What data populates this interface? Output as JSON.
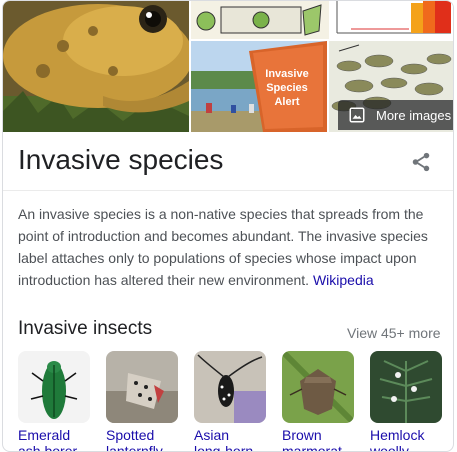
{
  "gallery": {
    "more_images_label": "More images",
    "sign_text_line1": "Invasive",
    "sign_text_line2": "Species",
    "sign_text_line3": "Alert"
  },
  "entity": {
    "title": "Invasive species",
    "description": "An invasive species is a non-native species that spreads from the point of introduction and becomes abundant. The invasive species label attaches only to populations of species whose impact upon introduction has altered their new environment.",
    "source_link": "Wikipedia"
  },
  "insects_section": {
    "title": "Invasive insects",
    "view_more": "View 45+ more",
    "items": [
      {
        "line1": "Emerald",
        "line2": "ash borer"
      },
      {
        "line1": "Spotted",
        "line2": "lanternfly"
      },
      {
        "line1": "Asian",
        "line2": "long-horn"
      },
      {
        "line1": "Brown",
        "line2": "marmorat"
      },
      {
        "line1": "Hemlock",
        "line2": "woolly"
      }
    ]
  },
  "colors": {
    "link": "#1a0dab",
    "text_secondary": "#4d5156",
    "border": "#dadce0"
  }
}
